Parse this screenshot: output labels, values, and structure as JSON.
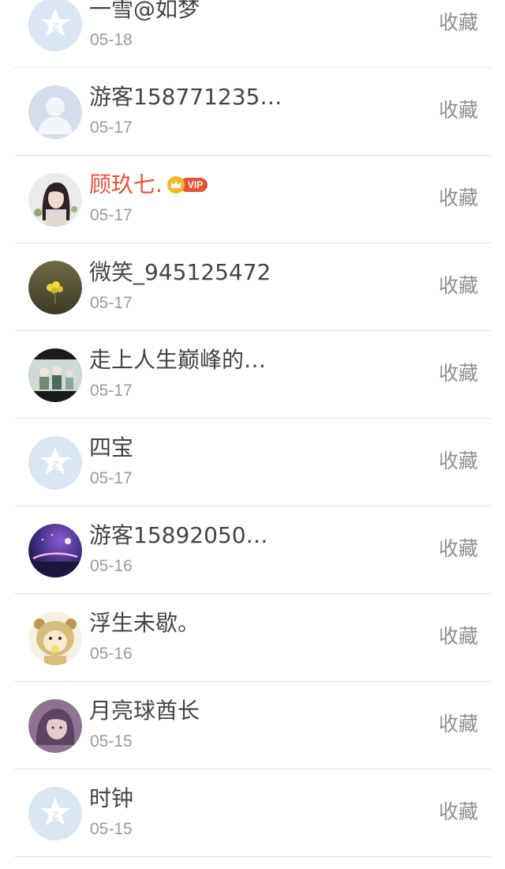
{
  "favorites": {
    "action_label": "收藏",
    "vip_tag": "VIP",
    "items": [
      {
        "name": "一雪@如梦",
        "date": "05-18",
        "avatar": "default-qzone-avatar"
      },
      {
        "name": "游客158771235…",
        "date": "05-17",
        "avatar": "default-person-avatar"
      },
      {
        "name": "顾玖七.",
        "date": "05-17",
        "avatar": "photo-girl-avatar",
        "vip": true,
        "name_color": "#e8533a"
      },
      {
        "name": "微笑_945125472",
        "date": "05-17",
        "avatar": "photo-flower-avatar"
      },
      {
        "name": "走上人生巅峰的…",
        "date": "05-17",
        "avatar": "photo-group-avatar"
      },
      {
        "name": "四宝",
        "date": "05-17",
        "avatar": "default-qzone-avatar"
      },
      {
        "name": "游客15892050…",
        "date": "05-16",
        "avatar": "photo-planet-avatar"
      },
      {
        "name": "浮生未歇。",
        "date": "05-16",
        "avatar": "cartoon-bear-avatar"
      },
      {
        "name": "月亮球酋长",
        "date": "05-15",
        "avatar": "anime-purple-avatar"
      },
      {
        "name": "时钟",
        "date": "05-15",
        "avatar": "default-qzone-avatar"
      }
    ]
  },
  "colors": {
    "name_text": "#444444",
    "date_text": "#9a9a9a",
    "action_text": "#8f8f8f",
    "vip_red": "#e8533a",
    "vip_gold": "#f3b62e",
    "divider": "#e3e3e3"
  }
}
